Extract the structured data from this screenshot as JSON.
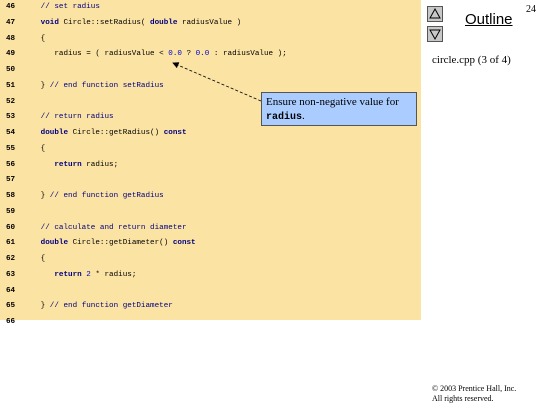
{
  "slide": {
    "page_number": "24",
    "outline_label": "Outline",
    "file_label": "circle.cpp (3 of 4)",
    "copyright_line1": "© 2003 Prentice Hall, Inc.",
    "copyright_line2": "All rights reserved."
  },
  "nav": {
    "up_icon": "triangle-up-icon",
    "down_icon": "triangle-down-icon"
  },
  "callout": {
    "text_prefix": "Ensure non-negative value for",
    "text_code": "radius",
    "text_suffix": "."
  },
  "code": [
    {
      "n": "46",
      "t": "   // set radius"
    },
    {
      "n": "47",
      "t": "   void Circle::setRadius( double radiusValue )"
    },
    {
      "n": "48",
      "t": "   {"
    },
    {
      "n": "49",
      "t": "      radius = ( radiusValue < 0.0 ? 0.0 : radiusValue );"
    },
    {
      "n": "50",
      "t": ""
    },
    {
      "n": "51",
      "t": "   } // end function setRadius"
    },
    {
      "n": "52",
      "t": ""
    },
    {
      "n": "53",
      "t": "   // return radius"
    },
    {
      "n": "54",
      "t": "   double Circle::getRadius() const"
    },
    {
      "n": "55",
      "t": "   {"
    },
    {
      "n": "56",
      "t": "      return radius;"
    },
    {
      "n": "57",
      "t": ""
    },
    {
      "n": "58",
      "t": "   } // end function getRadius"
    },
    {
      "n": "59",
      "t": ""
    },
    {
      "n": "60",
      "t": "   // calculate and return diameter"
    },
    {
      "n": "61",
      "t": "   double Circle::getDiameter() const"
    },
    {
      "n": "62",
      "t": "   {"
    },
    {
      "n": "63",
      "t": "      return 2 * radius;"
    },
    {
      "n": "64",
      "t": ""
    },
    {
      "n": "65",
      "t": "   } // end function getDiameter"
    },
    {
      "n": "66",
      "t": ""
    }
  ],
  "colors": {
    "code_bg": "#fbe3a3",
    "callout_bg": "#aaccff",
    "keyword": "#000080"
  }
}
